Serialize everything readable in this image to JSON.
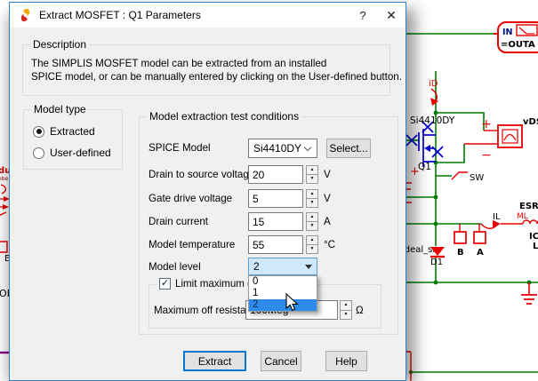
{
  "colors": {
    "accent_blue": "#0078d7",
    "dialog_border": "#2e82c8",
    "focused_combo_bg": "#cfe8fb",
    "list_highlight": "#2d8ceb",
    "wire_green": "#007d00",
    "component_red": "#e80000",
    "mosfet_blue": "#0000cd",
    "purple_wire": "#8a008a"
  },
  "window": {
    "title": "Extract MOSFET : Q1 Parameters",
    "help_button": "?",
    "close_button": "✕"
  },
  "description": {
    "group_label": "Description",
    "line1": "The SIMPLIS MOSFET model can be extracted from an installed",
    "line2": "SPICE model, or can be manually entered by clicking on the User-defined button."
  },
  "model_type": {
    "group_label": "Model type",
    "extracted_label": "Extracted",
    "user_defined_label": "User-defined",
    "selected": "Extracted"
  },
  "conditions": {
    "group_label": "Model extraction test conditions",
    "spice_model": {
      "label": "SPICE Model",
      "value": "Si4410DY",
      "select_button": "Select..."
    },
    "rows": [
      {
        "label": "Drain to source voltage",
        "value": "20",
        "unit": "V"
      },
      {
        "label": "Gate drive voltage",
        "value": "5",
        "unit": "V"
      },
      {
        "label": "Drain current",
        "value": "15",
        "unit": "A"
      },
      {
        "label": "Model temperature",
        "value": "55",
        "unit": "°C"
      }
    ],
    "model_level": {
      "label": "Model level",
      "value": "2",
      "options": [
        "0",
        "1",
        "2"
      ],
      "highlighted_option": "2"
    },
    "limit_checkbox": {
      "label": "Limit maximum off resistance",
      "checked": true
    },
    "max_off_resistance": {
      "label": "Maximum off resistance",
      "value": "100Meg",
      "unit": "Ω"
    }
  },
  "action_buttons": {
    "extract": "Extract",
    "cancel": "Cancel",
    "help": "Help"
  },
  "schematic": {
    "in_label": "IN",
    "out_label": "=OUTA",
    "id_probe": "iD",
    "mosfet_model": "Si4410DY",
    "mosfet_ref": "Q1",
    "vds_label": "vDS",
    "plus": "+",
    "minus": "−",
    "sw_label": "SW",
    "esr_label": "ESR=",
    "ml_label": "ML",
    "il_label": "IL",
    "ic_label": "IC",
    "l_label": "L",
    "probe_b": "B",
    "probe_a": "A",
    "diode_model": "ideal_sr",
    "diode_ref": "D1",
    "bottom_b": "B",
    "left_fragment_1": "duc",
    "left_fragment_2": "obe",
    "left_fragment_3": "E",
    "left_fragment_4": "OB"
  }
}
